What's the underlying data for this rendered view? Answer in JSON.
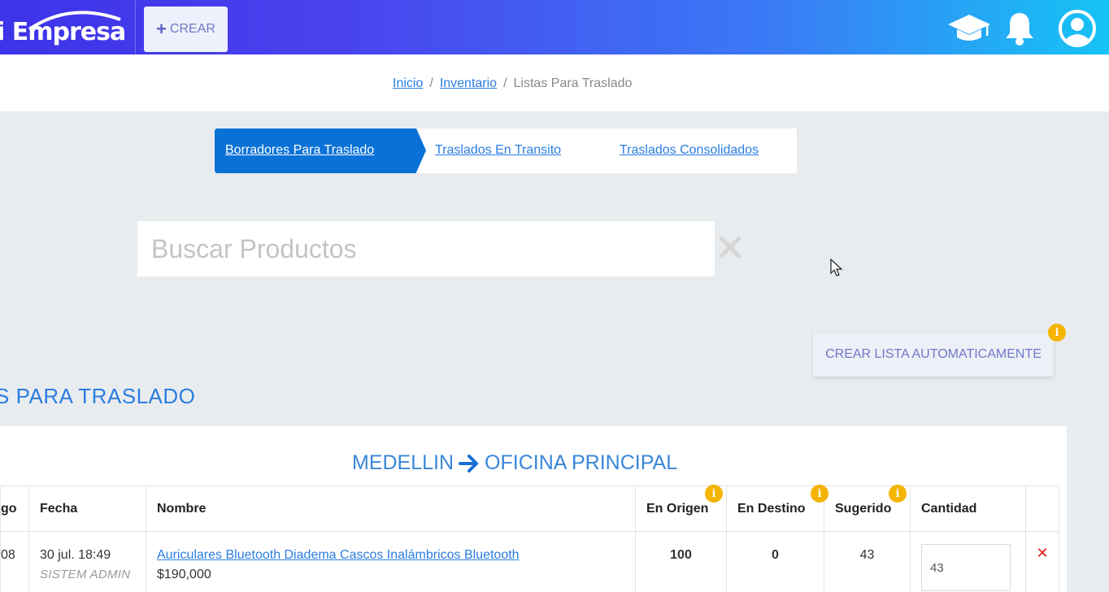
{
  "header": {
    "logo_text": "i Empresa",
    "create_label": "CREAR",
    "create_icon": "plus-icon",
    "icons": [
      "graduation-cap-icon",
      "bell-icon",
      "user-avatar-icon"
    ]
  },
  "breadcrumb": {
    "items": [
      "Inicio",
      "Inventario"
    ],
    "current": "Listas Para Traslado",
    "separator": "/"
  },
  "tabs": [
    {
      "label": "Borradores Para Traslado",
      "active": true
    },
    {
      "label": "Traslados En Transito",
      "active": false
    },
    {
      "label": "Traslados Consolidados",
      "active": false
    }
  ],
  "search": {
    "placeholder": "Buscar Productos",
    "value": "",
    "clear_icon": "close-icon"
  },
  "auto_button": {
    "label": "CREAR LISTA AUTOMATICAMENTE",
    "info_icon": "info-icon"
  },
  "section_title": "S PARA TRASLADO",
  "route": {
    "origin": "MEDELLIN",
    "destination": "OFICINA PRINCIPAL",
    "arrow_icon": "arrow-right-icon"
  },
  "table": {
    "headers": {
      "code": "go",
      "fecha": "Fecha",
      "nombre": "Nombre",
      "en_origen": "En Origen",
      "en_destino": "En Destino",
      "sugerido": "Sugerido",
      "cantidad": "Cantidad"
    },
    "rows": [
      {
        "code": "08",
        "fecha": "30 jul. 18:49",
        "user": "SISTEM ADMIN",
        "nombre": "Auriculares Bluetooth Diadema Cascos Inalámbricos Bluetooth",
        "precio": "$190,000",
        "en_origen": "100",
        "en_destino": "0",
        "sugerido": "43",
        "cantidad": "43"
      }
    ]
  },
  "colors": {
    "primary": "#0a72d6",
    "link": "#2a7de1",
    "badge": "#f4b400",
    "delete": "#e01919"
  }
}
